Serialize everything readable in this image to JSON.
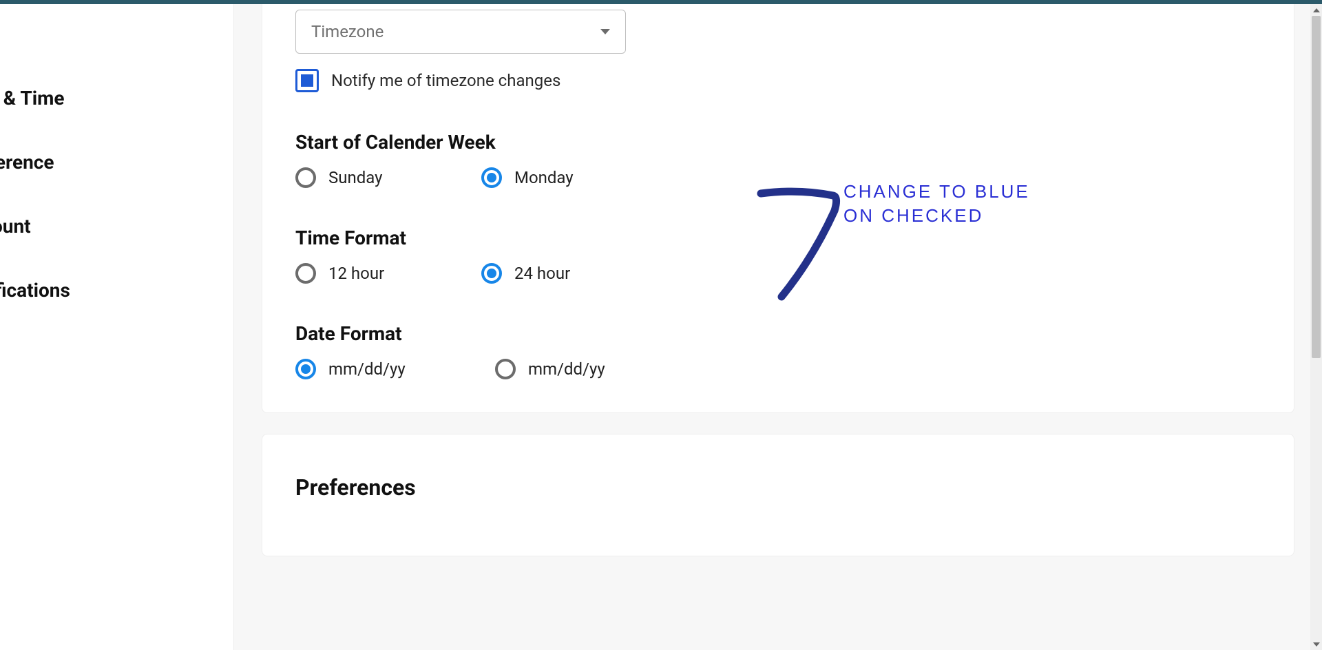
{
  "sidebar": {
    "items": [
      {
        "label": "Date & Time"
      },
      {
        "label": "Preference"
      },
      {
        "label": "Account"
      },
      {
        "label": "Notifications"
      }
    ]
  },
  "timezone": {
    "placeholder": "Timezone",
    "notify_label": "Notify me of timezone changes",
    "notify_checked": true
  },
  "sections": {
    "week": {
      "title": "Start of Calender Week",
      "options": [
        {
          "label": "Sunday",
          "checked": false
        },
        {
          "label": "Monday",
          "checked": true
        }
      ]
    },
    "time_format": {
      "title": "Time Format",
      "options": [
        {
          "label": "12 hour",
          "checked": false
        },
        {
          "label": "24 hour",
          "checked": true
        }
      ]
    },
    "date_format": {
      "title": "Date Format",
      "options": [
        {
          "label": "mm/dd/yy",
          "checked": true
        },
        {
          "label": "mm/dd/yy",
          "checked": false
        }
      ]
    }
  },
  "preferences": {
    "title": "Preferences"
  },
  "annotation": {
    "line1": "CHANGE  TO  BLUE",
    "line2": "ON CHECKED"
  }
}
